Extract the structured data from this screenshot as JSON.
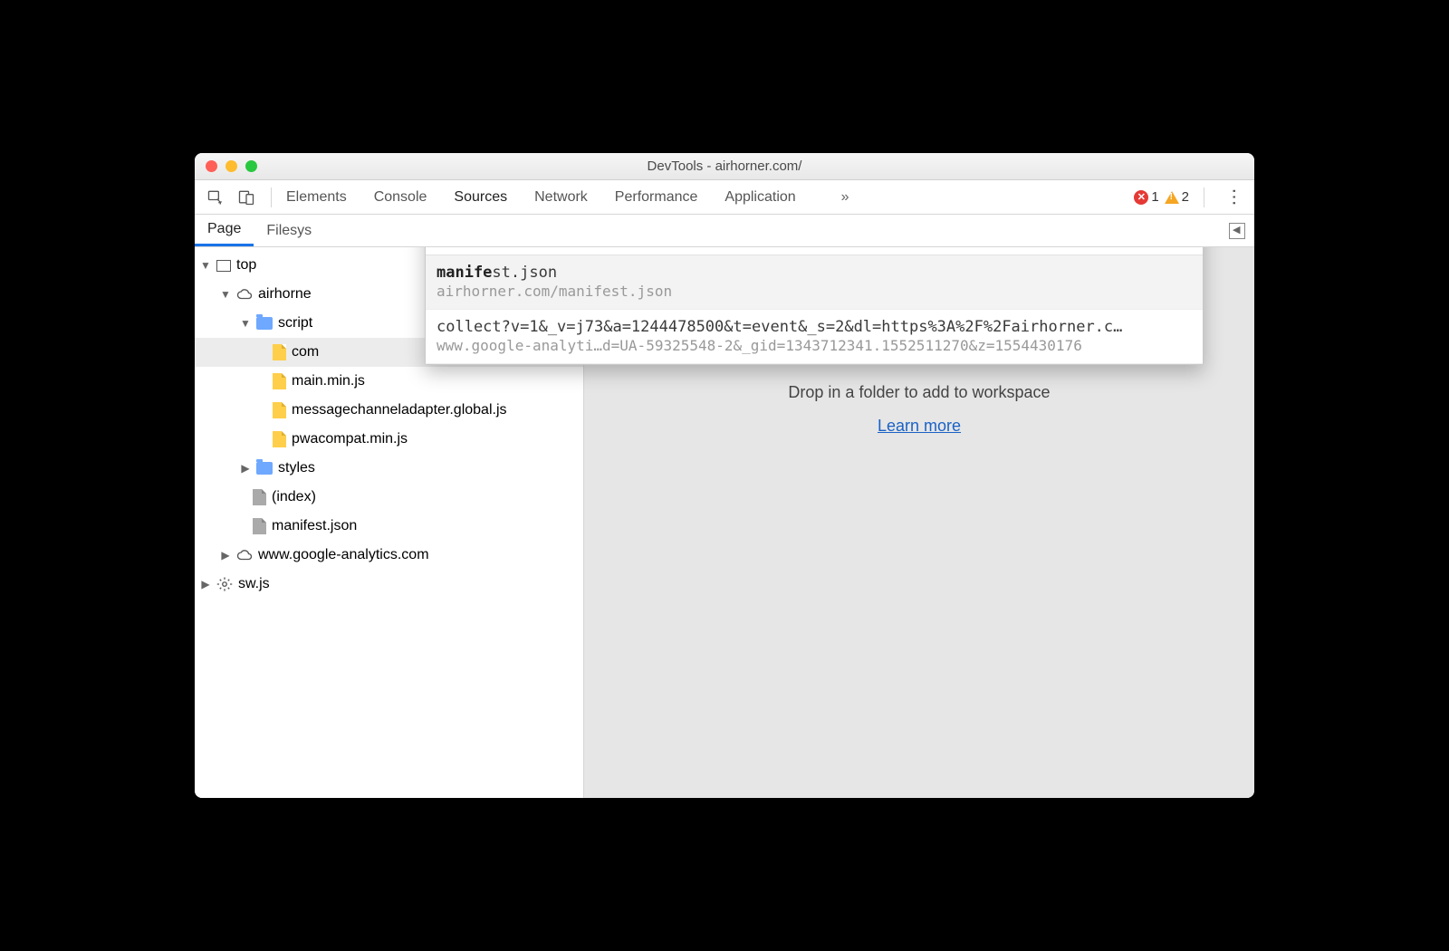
{
  "window": {
    "title": "DevTools - airhorner.com/"
  },
  "tabs": {
    "items": [
      "Elements",
      "Console",
      "Sources",
      "Network",
      "Performance",
      "Application"
    ],
    "active": "Sources",
    "more_glyph": "»"
  },
  "errors": {
    "error_count": "1",
    "warning_count": "2"
  },
  "subtabs": {
    "page": "Page",
    "filesystem": "Filesys"
  },
  "tree": {
    "top": "top",
    "domain1": "airhorne",
    "scripts_label": "script",
    "scripts": [
      "com",
      "main.min.js",
      "messagechanneladapter.global.js",
      "pwacompat.min.js"
    ],
    "styles_label": "styles",
    "index_label": "(index)",
    "manifest_label": "manifest.json",
    "domain2": "www.google-analytics.com",
    "sw_label": "sw.js"
  },
  "content": {
    "drop_text": "Drop in a folder to add to workspace",
    "learn_more": "Learn more"
  },
  "popup": {
    "query": "manife",
    "results": [
      {
        "match_bold": "manife",
        "match_rest": "st.json",
        "sub": "airhorner.com/manifest.json",
        "highlighted": true
      },
      {
        "match_bold": "",
        "match_rest": "collect?v=1&_v=j73&a=1244478500&t=event&_s=2&dl=https%3A%2F%2Fairhorner.c…",
        "sub": "www.google-analyti…d=UA-59325548-2&_gid=1343712341.1552511270&z=1554430176",
        "highlighted": false
      }
    ]
  }
}
